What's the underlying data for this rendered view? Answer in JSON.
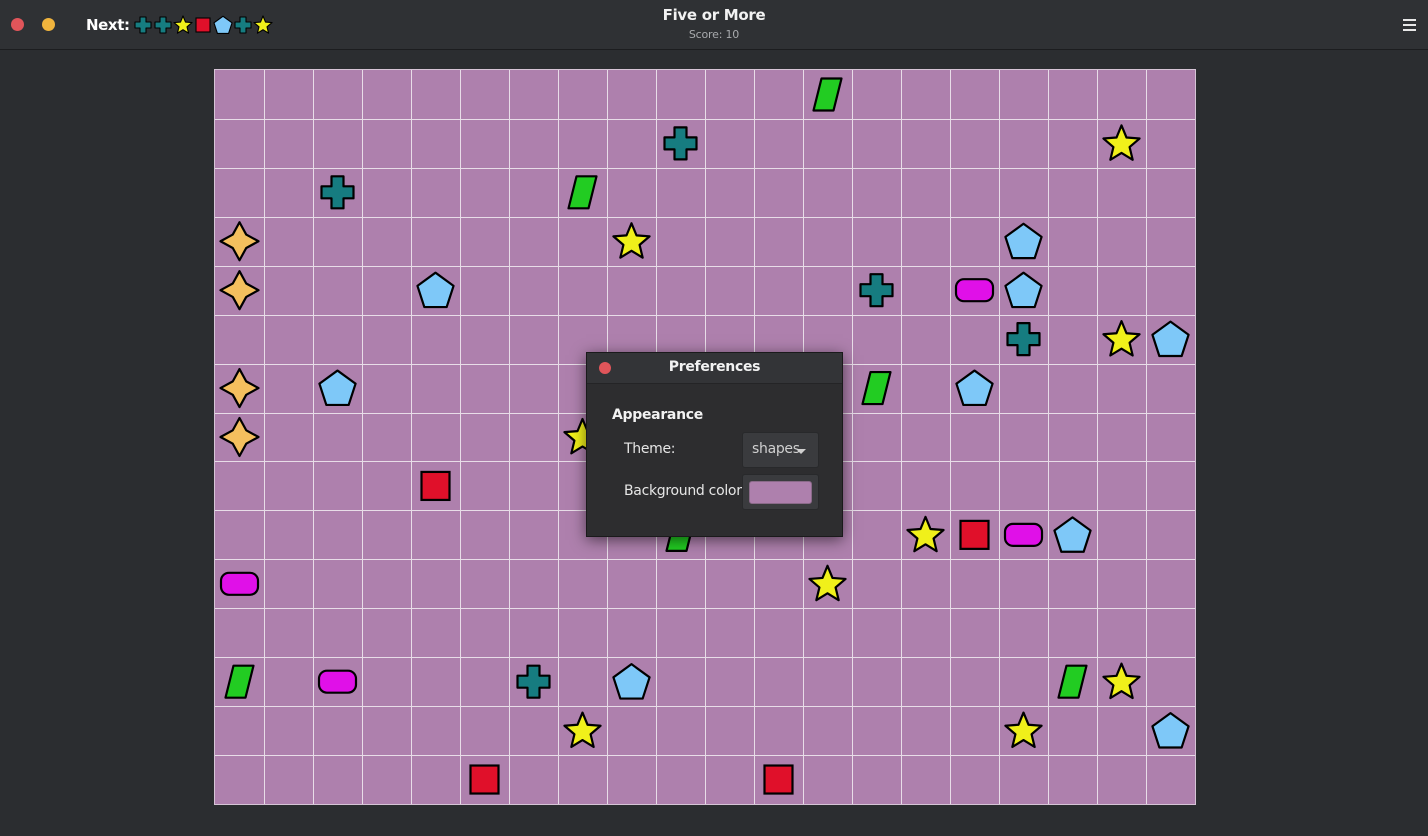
{
  "window": {
    "title": "Five or More",
    "score_text": "Score: 10"
  },
  "next": {
    "label": "Next:",
    "pieces": [
      "cross",
      "cross",
      "star",
      "square",
      "pentagon",
      "cross",
      "star"
    ]
  },
  "colors": {
    "board": "#ae80ad",
    "grid": "#ffffff",
    "cross": "#167c80",
    "star": "#f0f01a",
    "square": "#e0102a",
    "pentagon": "#7ec8f8",
    "parallelogram": "#22cc22",
    "pill": "#e010e8",
    "spark": "#f4bf5e"
  },
  "board": {
    "cols": 20,
    "rows": 15,
    "pieces": [
      {
        "c": 12,
        "r": 0,
        "t": "parallelogram"
      },
      {
        "c": 9,
        "r": 1,
        "t": "cross"
      },
      {
        "c": 18,
        "r": 1,
        "t": "star"
      },
      {
        "c": 2,
        "r": 2,
        "t": "cross"
      },
      {
        "c": 7,
        "r": 2,
        "t": "parallelogram"
      },
      {
        "c": 0,
        "r": 3,
        "t": "spark"
      },
      {
        "c": 8,
        "r": 3,
        "t": "star"
      },
      {
        "c": 16,
        "r": 3,
        "t": "pentagon"
      },
      {
        "c": 0,
        "r": 4,
        "t": "spark"
      },
      {
        "c": 4,
        "r": 4,
        "t": "pentagon"
      },
      {
        "c": 13,
        "r": 4,
        "t": "cross"
      },
      {
        "c": 15,
        "r": 4,
        "t": "pill"
      },
      {
        "c": 16,
        "r": 4,
        "t": "pentagon"
      },
      {
        "c": 16,
        "r": 5,
        "t": "cross"
      },
      {
        "c": 18,
        "r": 5,
        "t": "star"
      },
      {
        "c": 19,
        "r": 5,
        "t": "pentagon"
      },
      {
        "c": 0,
        "r": 6,
        "t": "spark"
      },
      {
        "c": 2,
        "r": 6,
        "t": "pentagon"
      },
      {
        "c": 13,
        "r": 6,
        "t": "parallelogram"
      },
      {
        "c": 15,
        "r": 6,
        "t": "pentagon"
      },
      {
        "c": 0,
        "r": 7,
        "t": "spark"
      },
      {
        "c": 7,
        "r": 7,
        "t": "star"
      },
      {
        "c": 4,
        "r": 8,
        "t": "square"
      },
      {
        "c": 9,
        "r": 9,
        "t": "parallelogram"
      },
      {
        "c": 14,
        "r": 9,
        "t": "star"
      },
      {
        "c": 15,
        "r": 9,
        "t": "square"
      },
      {
        "c": 16,
        "r": 9,
        "t": "pill"
      },
      {
        "c": 17,
        "r": 9,
        "t": "pentagon"
      },
      {
        "c": 0,
        "r": 10,
        "t": "pill"
      },
      {
        "c": 12,
        "r": 10,
        "t": "star"
      },
      {
        "c": 0,
        "r": 12,
        "t": "parallelogram"
      },
      {
        "c": 2,
        "r": 12,
        "t": "pill"
      },
      {
        "c": 6,
        "r": 12,
        "t": "cross"
      },
      {
        "c": 8,
        "r": 12,
        "t": "pentagon"
      },
      {
        "c": 17,
        "r": 12,
        "t": "parallelogram"
      },
      {
        "c": 18,
        "r": 12,
        "t": "star"
      },
      {
        "c": 7,
        "r": 13,
        "t": "star"
      },
      {
        "c": 16,
        "r": 13,
        "t": "star"
      },
      {
        "c": 19,
        "r": 13,
        "t": "pentagon"
      },
      {
        "c": 5,
        "r": 14,
        "t": "square"
      },
      {
        "c": 11,
        "r": 14,
        "t": "square"
      }
    ]
  },
  "preferences": {
    "title": "Preferences",
    "section": "Appearance",
    "theme_label": "Theme:",
    "theme_value": "shapes",
    "bgcolor_label": "Background color:",
    "bgcolor_value": "#ae80ad"
  },
  "icons": {
    "close": "close-icon",
    "minimize": "minimize-icon",
    "menu": "hamburger-menu-icon",
    "dropdown": "chevron-down-icon"
  }
}
